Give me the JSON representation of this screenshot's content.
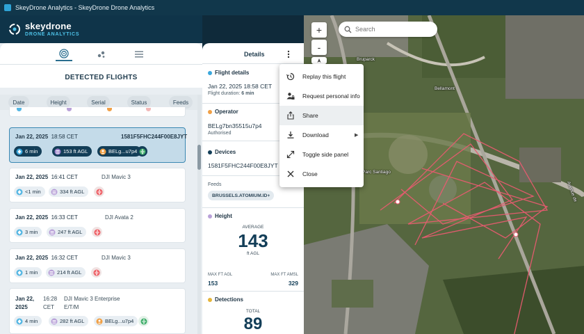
{
  "window": {
    "title": "SkeyDrone Analytics - SkeyDrone Drone Analytics"
  },
  "brand": {
    "name": "skeydrone",
    "sub": "DRONE ANALYTICS"
  },
  "left": {
    "title": "DETECTED FLIGHTS",
    "filters": [
      "Date",
      "Height",
      "Serial",
      "Status",
      "Feeds"
    ]
  },
  "flights": [
    {
      "date": "Jan 22, 2025",
      "time": "18:58 CET",
      "serial": "1581F5FHC244F00E8JYT",
      "duration": "6 min",
      "height": "153 ft AGL",
      "operator": "BELg...u7p4"
    },
    {
      "date": "Jan 22, 2025",
      "time": "16:41 CET",
      "model": "DJI Mavic 3",
      "duration": "<1 min",
      "height": "334 ft AGL"
    },
    {
      "date": "Jan 22, 2025",
      "time": "16:33 CET",
      "model": "DJI Avata 2",
      "duration": "3 min",
      "height": "247 ft AGL"
    },
    {
      "date": "Jan 22, 2025",
      "time": "16:32 CET",
      "model": "DJI Mavic 3",
      "duration": "1 min",
      "height": "214 ft AGL"
    },
    {
      "date_line1": "Jan 22,",
      "date_line2": "2025",
      "time_line1": "16:28",
      "time_line2": "CET",
      "model_line1": "DJI Mavic 3 Enterprise",
      "model_line2": "E/T/M",
      "duration": "4 min",
      "height": "282 ft AGL",
      "operator": "BELg...u7p4"
    }
  ],
  "details": {
    "title": "Details",
    "flight": {
      "heading": "Flight details",
      "datetime": "Jan 22, 2025 18:58 CET",
      "duration_label": "Flight duration:",
      "duration": "6 min"
    },
    "operator": {
      "heading": "Operator",
      "id": "BELg7bn35515u7p4",
      "status": "Authorised"
    },
    "devices": {
      "heading": "Devices",
      "serial": "1581F5FHC244F00E8JYT"
    },
    "feeds": {
      "label": "Feeds",
      "tag": "BRUSSELS.ATOMIUM.ID+"
    },
    "height": {
      "heading": "Height",
      "avg_label": "AVERAGE",
      "avg": "143",
      "avg_unit": "ft AGL",
      "max_agl_label": "MAX FT AGL",
      "max_agl": "153",
      "max_amsl_label": "MAX FT AMSL",
      "max_amsl": "329"
    },
    "detections": {
      "heading": "Detections",
      "total_label": "TOTAL",
      "total": "89"
    }
  },
  "menu": {
    "items": [
      {
        "label": "Replay this flight",
        "icon": "history-icon"
      },
      {
        "label": "Request personal info",
        "icon": "person-lock-icon"
      },
      {
        "label": "Share",
        "icon": "share-icon"
      },
      {
        "label": "Download",
        "icon": "download-icon"
      },
      {
        "label": "Toggle side panel",
        "icon": "expand-icon"
      },
      {
        "label": "Close",
        "icon": "close-icon"
      }
    ],
    "highlighted": "Share"
  },
  "map": {
    "search_placeholder": "Search",
    "zoom_in": "+",
    "zoom_out": "-",
    "labels": [
      "Bruparck",
      "Bellamont",
      "Parc Santiago",
      "Avenue de"
    ]
  },
  "colors": {
    "accent": "#3b88b2",
    "navy": "#133e58",
    "track": "#e0556a"
  }
}
